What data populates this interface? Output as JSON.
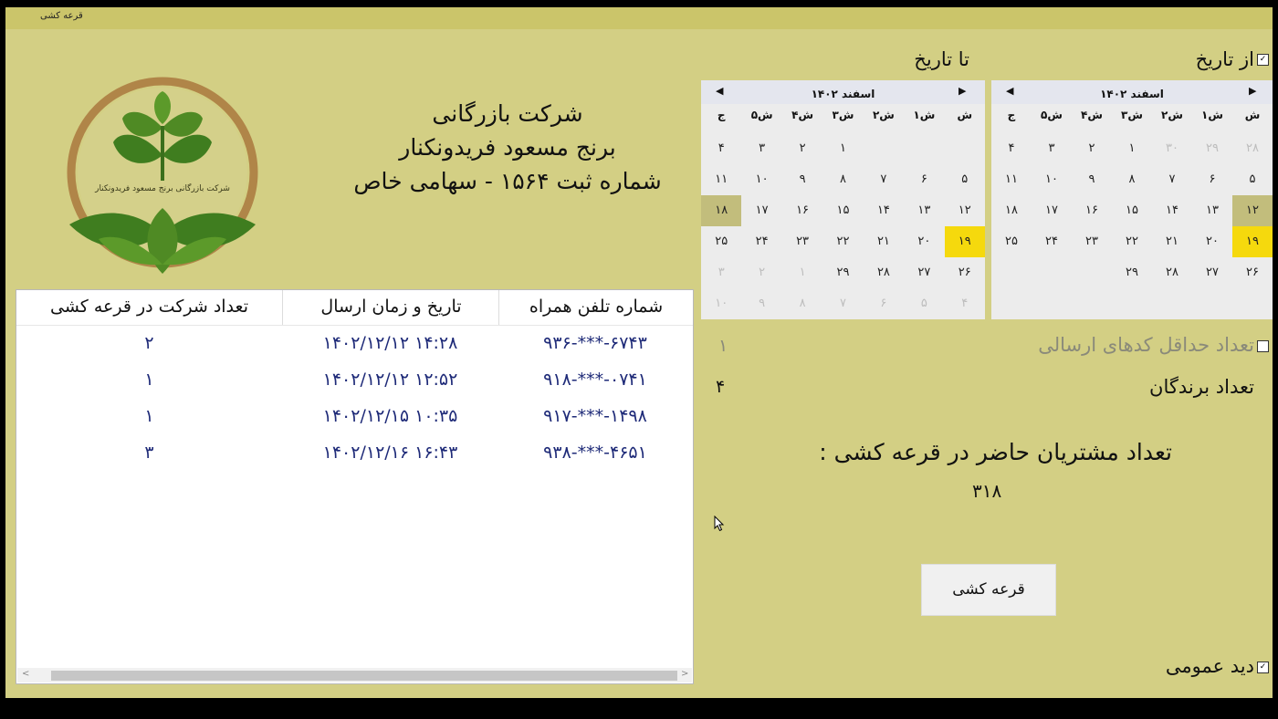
{
  "window": {
    "title": "قرعه کشی"
  },
  "company": {
    "line1": "شرکت بازرگانی",
    "line2": "برنج مسعود فریدونکنار",
    "line3": "شماره ثبت ۱۵۶۴ - سهامی خاص",
    "logo_text": "شرکت بازرگانی برنج مسعود فریدونکنار"
  },
  "labels": {
    "from_date": "از تاریخ",
    "to_date": "تا تاریخ"
  },
  "weekdays": [
    "ش",
    "۱ش",
    "۲ش",
    "۳ش",
    "۴ش",
    "۵ش",
    "ج"
  ],
  "from_calendar": {
    "month_label": "اسفند ۱۴۰۲",
    "rows": [
      [
        {
          "t": "۲۸",
          "m": true
        },
        {
          "t": "۲۹",
          "m": true
        },
        {
          "t": "۳۰",
          "m": true
        },
        {
          "t": "۱"
        },
        {
          "t": "۲"
        },
        {
          "t": "۳"
        },
        {
          "t": "۴"
        }
      ],
      [
        {
          "t": "۵"
        },
        {
          "t": "۶"
        },
        {
          "t": "۷"
        },
        {
          "t": "۸"
        },
        {
          "t": "۹"
        },
        {
          "t": "۱۰"
        },
        {
          "t": "۱۱"
        }
      ],
      [
        {
          "t": "۱۲",
          "s": true
        },
        {
          "t": "۱۳"
        },
        {
          "t": "۱۴"
        },
        {
          "t": "۱۵"
        },
        {
          "t": "۱۶"
        },
        {
          "t": "۱۷"
        },
        {
          "t": "۱۸"
        }
      ],
      [
        {
          "t": "۱۹",
          "today": true
        },
        {
          "t": "۲۰"
        },
        {
          "t": "۲۱"
        },
        {
          "t": "۲۲"
        },
        {
          "t": "۲۳"
        },
        {
          "t": "۲۴"
        },
        {
          "t": "۲۵"
        }
      ],
      [
        {
          "t": "۲۶"
        },
        {
          "t": "۲۷"
        },
        {
          "t": "۲۸"
        },
        {
          "t": "۲۹"
        },
        {
          "t": ""
        },
        {
          "t": ""
        },
        {
          "t": ""
        }
      ]
    ]
  },
  "to_calendar": {
    "month_label": "اسفند ۱۴۰۲",
    "rows": [
      [
        {
          "t": ""
        },
        {
          "t": ""
        },
        {
          "t": ""
        },
        {
          "t": "۱"
        },
        {
          "t": "۲"
        },
        {
          "t": "۳"
        },
        {
          "t": "۴"
        }
      ],
      [
        {
          "t": "۵"
        },
        {
          "t": "۶"
        },
        {
          "t": "۷"
        },
        {
          "t": "۸"
        },
        {
          "t": "۹"
        },
        {
          "t": "۱۰"
        },
        {
          "t": "۱۱"
        }
      ],
      [
        {
          "t": "۱۲"
        },
        {
          "t": "۱۳"
        },
        {
          "t": "۱۴"
        },
        {
          "t": "۱۵"
        },
        {
          "t": "۱۶"
        },
        {
          "t": "۱۷"
        },
        {
          "t": "۱۸",
          "s": true
        }
      ],
      [
        {
          "t": "۱۹",
          "today": true
        },
        {
          "t": "۲۰"
        },
        {
          "t": "۲۱"
        },
        {
          "t": "۲۲"
        },
        {
          "t": "۲۳"
        },
        {
          "t": "۲۴"
        },
        {
          "t": "۲۵"
        }
      ],
      [
        {
          "t": "۲۶"
        },
        {
          "t": "۲۷"
        },
        {
          "t": "۲۸"
        },
        {
          "t": "۲۹"
        },
        {
          "t": "۱",
          "m": true
        },
        {
          "t": "۲",
          "m": true
        },
        {
          "t": "۳",
          "m": true
        }
      ],
      [
        {
          "t": "۴",
          "m": true
        },
        {
          "t": "۵",
          "m": true
        },
        {
          "t": "۶",
          "m": true
        },
        {
          "t": "۷",
          "m": true
        },
        {
          "t": "۸",
          "m": true
        },
        {
          "t": "۹",
          "m": true
        },
        {
          "t": "۱۰",
          "m": true
        }
      ]
    ]
  },
  "table": {
    "headers": [
      "شماره تلفن همراه",
      "تاریخ و زمان ارسال",
      "تعداد شرکت در قرعه کشی"
    ],
    "rows": [
      [
        "۹۳۶-***-۶۷۴۳",
        "۱۴۰۲/۱۲/۱۲ ۱۴:۲۸",
        "۲"
      ],
      [
        "۹۱۸-***-۰۷۴۱",
        "۱۴۰۲/۱۲/۱۲ ۱۲:۵۲",
        "۱"
      ],
      [
        "۹۱۷-***-۱۴۹۸",
        "۱۴۰۲/۱۲/۱۵ ۱۰:۳۵",
        "۱"
      ],
      [
        "۹۳۸-***-۴۶۵۱",
        "۱۴۰۲/۱۲/۱۶ ۱۶:۴۳",
        "۳"
      ]
    ]
  },
  "form": {
    "min_codes_label": "تعداد حداقل کدهای ارسالی",
    "min_codes_value": "۱",
    "winners_label": "تعداد برندگان",
    "winners_value": "۴",
    "present_label": "تعداد مشتریان حاضر در قرعه کشی :",
    "present_value": "۳۱۸",
    "draw_button": "قرعه کشی",
    "overview_label": "دید عمومی"
  },
  "colors": {
    "window_bg": "#d3cf84",
    "titlebar": "#cbc56a",
    "today": "#f5d90d",
    "selected": "#c2bd7c",
    "table_text": "#1e2a78"
  }
}
